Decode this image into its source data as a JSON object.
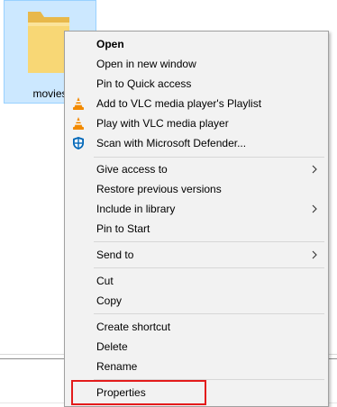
{
  "folder": {
    "name": "movies",
    "icon": "folder-icon",
    "selected": true
  },
  "context_menu": {
    "items": [
      {
        "label": "Open",
        "bold": true,
        "icon": null,
        "submenu": false
      },
      {
        "label": "Open in new window",
        "bold": false,
        "icon": null,
        "submenu": false
      },
      {
        "label": "Pin to Quick access",
        "bold": false,
        "icon": null,
        "submenu": false
      },
      {
        "label": "Add to VLC media player's Playlist",
        "bold": false,
        "icon": "vlc-cone-icon",
        "submenu": false
      },
      {
        "label": "Play with VLC media player",
        "bold": false,
        "icon": "vlc-cone-icon",
        "submenu": false
      },
      {
        "label": "Scan with Microsoft Defender...",
        "bold": false,
        "icon": "defender-shield-icon",
        "submenu": false
      },
      {
        "label": "Give access to",
        "bold": false,
        "icon": null,
        "submenu": true
      },
      {
        "label": "Restore previous versions",
        "bold": false,
        "icon": null,
        "submenu": false
      },
      {
        "label": "Include in library",
        "bold": false,
        "icon": null,
        "submenu": true
      },
      {
        "label": "Pin to Start",
        "bold": false,
        "icon": null,
        "submenu": false
      },
      {
        "label": "Send to",
        "bold": false,
        "icon": null,
        "submenu": true
      },
      {
        "label": "Cut",
        "bold": false,
        "icon": null,
        "submenu": false
      },
      {
        "label": "Copy",
        "bold": false,
        "icon": null,
        "submenu": false
      },
      {
        "label": "Create shortcut",
        "bold": false,
        "icon": null,
        "submenu": false
      },
      {
        "label": "Delete",
        "bold": false,
        "icon": null,
        "submenu": false
      },
      {
        "label": "Rename",
        "bold": false,
        "icon": null,
        "submenu": false
      },
      {
        "label": "Properties",
        "bold": false,
        "icon": null,
        "submenu": false
      }
    ]
  },
  "highlight": {
    "target": "Properties",
    "color": "#e31b1b"
  },
  "colors": {
    "selection_fill": "#cce8ff",
    "selection_border": "#99d1ff",
    "menu_background": "#f2f2f2",
    "folder_yellow": "#f8d775",
    "vlc_orange": "#f28a00",
    "defender_blue": "#0067b8"
  }
}
